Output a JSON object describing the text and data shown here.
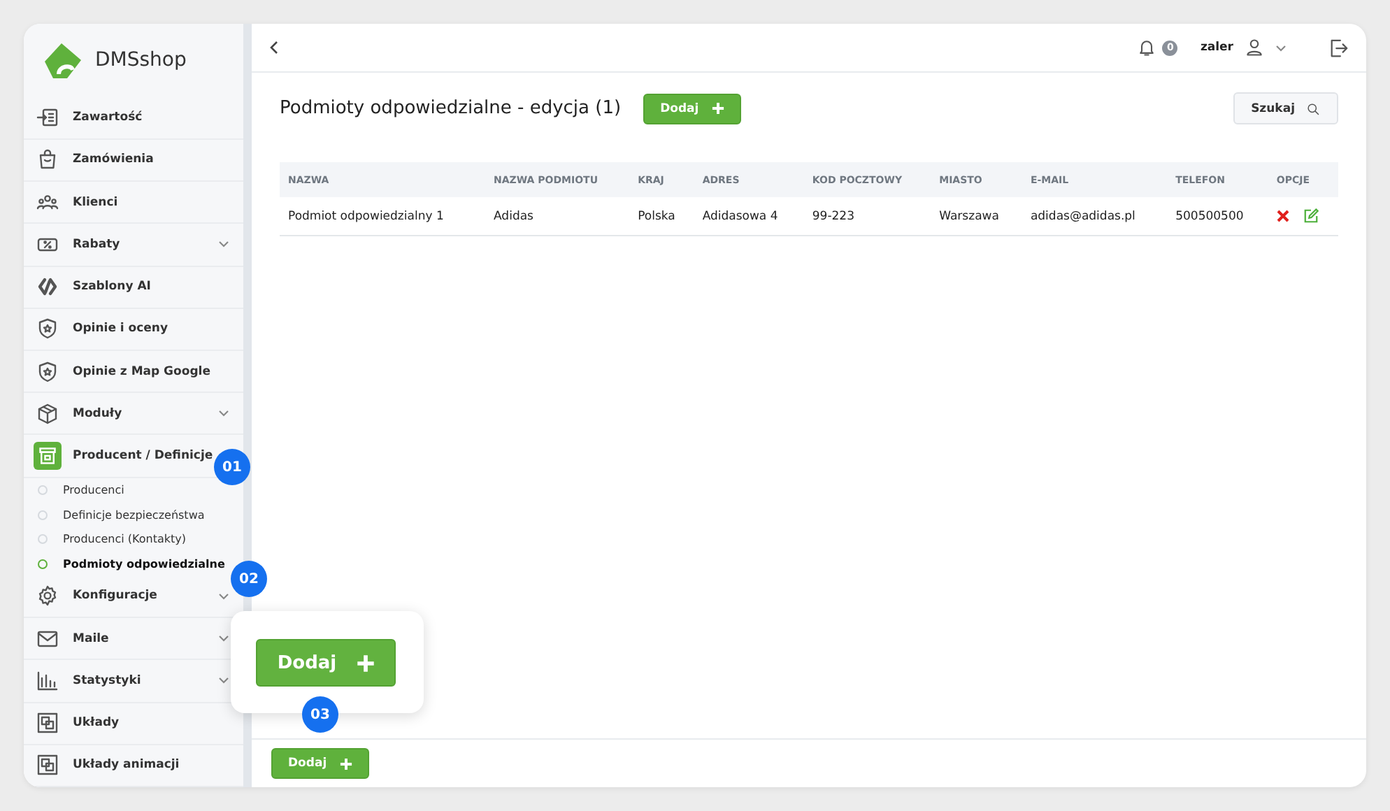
{
  "sidebar": {
    "logo": "DMSshop",
    "items": [
      {
        "label": "Zawartość",
        "expandable": false,
        "selected": false
      },
      {
        "label": "Zamówienia",
        "expandable": false,
        "selected": false
      },
      {
        "label": "Klienci",
        "expandable": false,
        "selected": false
      },
      {
        "label": "Rabaty",
        "expandable": true,
        "selected": false
      },
      {
        "label": "Szablony AI",
        "expandable": false,
        "selected": false
      },
      {
        "label": "Opinie i oceny",
        "expandable": false,
        "selected": false
      },
      {
        "label": "Opinie z Map Google",
        "expandable": false,
        "selected": false
      },
      {
        "label": "Moduły",
        "expandable": true,
        "selected": false
      },
      {
        "label": "Producent / Definicje",
        "expandable": false,
        "selected": true,
        "children": [
          {
            "label": "Producenci",
            "selected": false
          },
          {
            "label": "Definicje bezpieczeństwa",
            "selected": false
          },
          {
            "label": "Producenci (Kontakty)",
            "selected": false
          },
          {
            "label": "Podmioty odpowiedzialne",
            "selected": true
          }
        ]
      },
      {
        "label": "Konfiguracje",
        "expandable": true,
        "selected": false
      },
      {
        "label": "Maile",
        "expandable": true,
        "selected": false
      },
      {
        "label": "Statystyki",
        "expandable": true,
        "selected": false
      },
      {
        "label": "Układy",
        "expandable": false,
        "selected": false
      },
      {
        "label": "Układy animacji",
        "expandable": false,
        "selected": false
      }
    ]
  },
  "header": {
    "notifications": "0",
    "user": "zaler"
  },
  "page": {
    "title": "Podmioty odpowiedzialne - edycja (1)",
    "add_button": "Dodaj",
    "search_button": "Szukaj"
  },
  "table": {
    "columns": [
      "NAZWA",
      "NAZWA PODMIOTU",
      "KRAJ",
      "ADRES",
      "KOD POCZTOWY",
      "MIASTO",
      "E-MAIL",
      "TELEFON",
      "OPCJE"
    ],
    "rows": [
      [
        "Podmiot odpowiedzialny 1",
        "Adidas",
        "Polska",
        "Adidasowa 4",
        "99-223",
        "Warszawa",
        "adidas@adidas.pl",
        "500500500"
      ]
    ]
  },
  "footer": {
    "add_button": "Dodaj"
  },
  "callout": {
    "button": "Dodaj"
  },
  "markers": [
    "01",
    "02",
    "03"
  ]
}
